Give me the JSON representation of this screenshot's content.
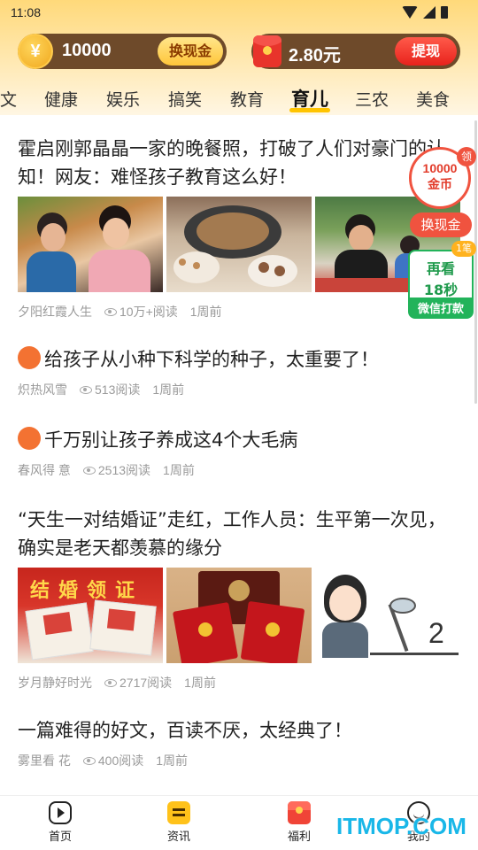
{
  "status_bar": {
    "time": "11:08"
  },
  "wallet": {
    "coin_symbol": "¥",
    "coins": "10000",
    "exchange_label": "换现金",
    "cash": "2.80元",
    "withdraw_label": "提现"
  },
  "tabs": [
    {
      "label": "文"
    },
    {
      "label": "健康"
    },
    {
      "label": "娱乐"
    },
    {
      "label": "搞笑"
    },
    {
      "label": "教育"
    },
    {
      "label": "育儿",
      "active": true
    },
    {
      "label": "三农"
    },
    {
      "label": "美食"
    }
  ],
  "articles": [
    {
      "title": "霍启刚郭晶晶一家的晚餐照，打破了人们对豪门的认知！网友：难怪孩子教育这么好！",
      "author": "夕阳红霞人生",
      "views": "10万+阅读",
      "time": "1周前"
    },
    {
      "title": "给孩子从小种下科学的种子，太重要了！",
      "author": "炽热风雪",
      "views": "513阅读",
      "time": "1周前"
    },
    {
      "title": "千万别让孩子养成这4个大毛病",
      "author": "春风得 意",
      "views": "2513阅读",
      "time": "1周前"
    },
    {
      "title": "“天生一对结婚证”走红，工作人员：生平第一次见，确实是老天都羡慕的缘分",
      "author": "岁月静好时光",
      "views": "2717阅读",
      "time": "1周前",
      "thumb_text": "结婚领证"
    },
    {
      "title": "一篇难得的好文，百读不厌，太经典了！",
      "author": "雾里看 花",
      "views": "400阅读",
      "time": "1周前"
    }
  ],
  "floating": {
    "reward_amount": "10000",
    "reward_unit": "金币",
    "reward_tag": "领",
    "exchange_label": "换现金",
    "watch_line1": "再看",
    "watch_line2": "18秒",
    "watch_footer": "微信打款",
    "watch_badge": "1笔"
  },
  "bottom_nav": [
    {
      "label": "首页",
      "icon": "play-home-icon"
    },
    {
      "label": "资讯",
      "icon": "news-icon",
      "active": true
    },
    {
      "label": "福利",
      "icon": "red-envelope-icon"
    },
    {
      "label": "我的",
      "icon": "profile-icon"
    }
  ],
  "watermark": "ITMOP.COM",
  "colors": {
    "accent_yellow": "#ffc400",
    "coin_red": "#f0533f",
    "video_green": "#22b35a",
    "meta_gray": "#9a9a9a",
    "watermark_blue": "#19b7e8"
  }
}
